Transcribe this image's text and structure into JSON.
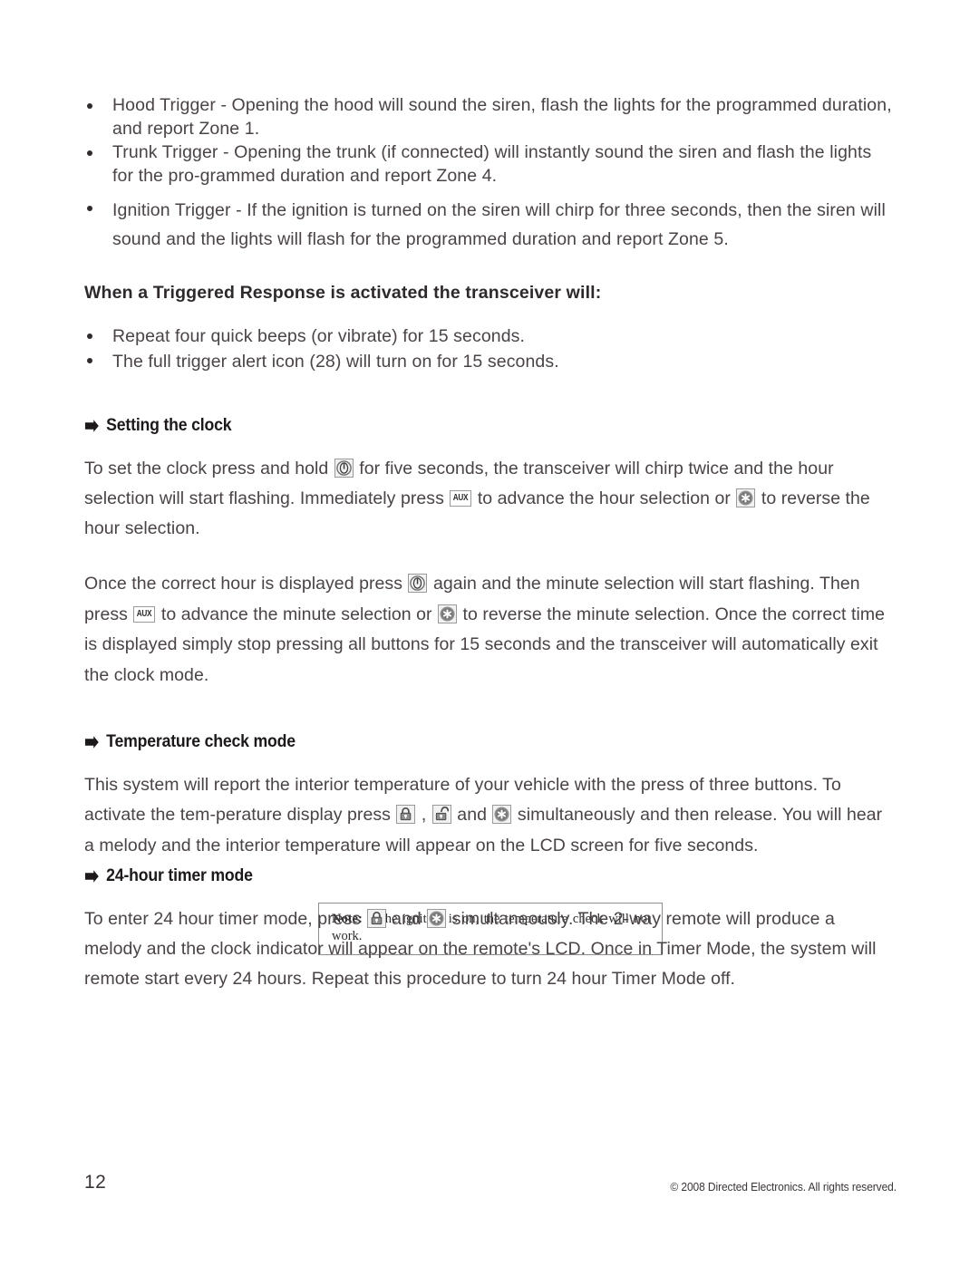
{
  "document": {
    "page_number": "12",
    "copyright": "© 2008 Directed Electronics. All rights reserved."
  },
  "triggers": {
    "items": [
      "Hood Trigger - Opening the hood will sound the siren, flash the lights for the programmed duration, and report Zone 1.",
      "Trunk Trigger - Opening the trunk (if connected) will instantly sound the siren and flash the lights for the pro-grammed duration and report Zone 4.",
      "Ignition Trigger - If the ignition is turned on the siren will chirp for three seconds, then the siren will sound and the lights will flash for the programmed duration and report Zone 5."
    ]
  },
  "triggered_response": {
    "heading": "When a Triggered Response is activated the transceiver will:",
    "items": [
      "Repeat four quick beeps (or vibrate) for 15 seconds.",
      "The full trigger alert icon (28) will turn on for 15 seconds."
    ]
  },
  "setting_clock": {
    "heading": "Setting the clock",
    "paragraph1": {
      "part1": "To set the clock press and hold",
      "icon1": "remote-start-icon",
      "part2": "for five seconds, the transceiver will chirp twice and the hour selection will start flashing. Immediately press",
      "icon2": "aux-button-icon",
      "part3": "to advance the hour selection or",
      "icon3": "star-button-icon",
      "part4": "to reverse the hour selection."
    },
    "paragraph2": {
      "part1": "Once the correct hour is displayed press",
      "icon1": "remote-start-icon",
      "part2": "again and the minute selection will start flashing. Then press",
      "icon2": "aux-button-icon",
      "part3": "to advance the minute selection or",
      "icon3": "star-button-icon",
      "part4": "to reverse the minute selection. Once the correct time is displayed simply stop pressing all buttons for 15  seconds and  the transceiver will automatically exit the clock mode."
    }
  },
  "temperature_check": {
    "heading": "Temperature check mode",
    "paragraph": {
      "part1": "This system will report the interior temperature of your vehicle with the press of three buttons. To activate the tem-perature display press",
      "icon1": "lock-button-icon",
      "part2": ",",
      "icon2": "unlock-button-icon",
      "part3": "and",
      "icon3": "star-button-icon",
      "part4": "simultaneously and then release. You will hear a melody and the interior temperature will appear on the LCD screen for five seconds."
    },
    "note": {
      "label": "Note:",
      "text": " If the ignition is on, the temperature check will not work."
    }
  },
  "timer_mode": {
    "heading": "24-hour timer mode",
    "paragraph": {
      "part1": "To enter 24 hour timer mode, press",
      "icon1": "lock-button-icon",
      "part2": "and",
      "icon2": "star-button-icon",
      "part3": "simultaneously. The 2-way remote will produce a melody and the clock indicator will appear on the remote's LCD. Once in Timer Mode, the system will remote start every 24 hours. Repeat this procedure to turn 24 hour Timer Mode off."
    }
  },
  "icons": {
    "arrow": "arrow-right-icon",
    "bullet": "bullet-dot-icon"
  }
}
